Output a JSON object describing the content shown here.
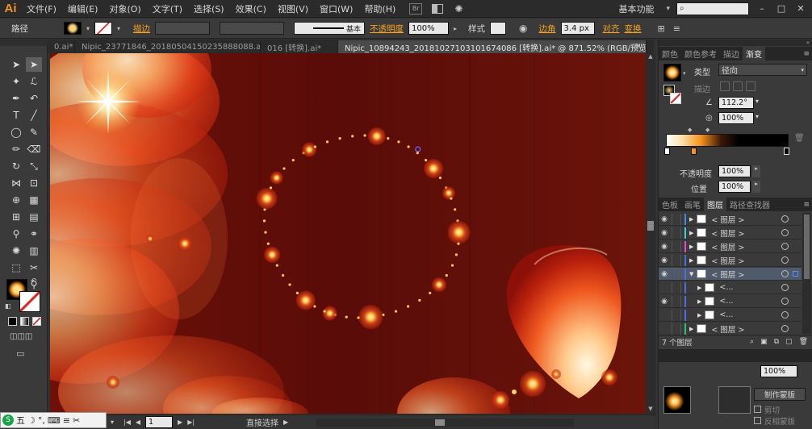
{
  "menubar": {
    "logo": "Ai",
    "menus": [
      "文件(F)",
      "编辑(E)",
      "对象(O)",
      "文字(T)",
      "选择(S)",
      "效果(C)",
      "视图(V)",
      "窗口(W)",
      "帮助(H)"
    ],
    "bridge": "Br",
    "workspace": "基本功能",
    "minimize": "–",
    "maximize": "□",
    "close": "✕"
  },
  "controlbar": {
    "selection_type": "路径",
    "stroke_label": "描边",
    "stroke_style": "基本",
    "opacity_label": "不透明度",
    "opacity_value": "100%",
    "style_label": "样式",
    "corner_label": "边角",
    "corner_value": "3.4 px",
    "align_label": "对齐",
    "transform_label": "变换"
  },
  "tabs": [
    {
      "label": "0.ai*",
      "active": false
    },
    {
      "label": "Nipic_23771846_20180504150235888088.ai*",
      "active": false
    },
    {
      "label": "016 [转换].ai*",
      "active": false
    },
    {
      "label": "Nipic_10894243_20181027103101674086 [转换].ai* @ 871.52% (RGB/预览)",
      "active": true
    }
  ],
  "status": {
    "zoom": "871.52%",
    "page": "1",
    "tool": "直接选择",
    "ime": [
      "五",
      "☽",
      "°,",
      "⌨",
      "≡",
      "✂"
    ]
  },
  "gradient_panel": {
    "tabs": [
      "颜色",
      "颜色参考",
      "描边",
      "渐变"
    ],
    "active_tab": "渐变",
    "type_label": "类型",
    "type_value": "径向",
    "stroke_label": "描边",
    "angle_value": "112.2°",
    "aspect_value": "100%",
    "opacity_label": "不透明度",
    "opacity_value": "100%",
    "location_label": "位置",
    "location_value": "100%"
  },
  "layers_panel": {
    "tabs": [
      "色板",
      "画笔",
      "图层",
      "路径查找器"
    ],
    "active_tab": "图层",
    "rows": [
      {
        "label": "< 图层 >",
        "indent": 0,
        "color": "#3a8ee6",
        "expanded": false,
        "eye": true
      },
      {
        "label": "< 图层 >",
        "indent": 0,
        "color": "#3bd0d0",
        "expanded": false,
        "eye": true
      },
      {
        "label": "< 图层 >",
        "indent": 0,
        "color": "#e04bd4",
        "expanded": false,
        "eye": true
      },
      {
        "label": "< 图层 >",
        "indent": 0,
        "color": "#4a6ee0",
        "expanded": false,
        "eye": true
      },
      {
        "label": "< 图层 >",
        "indent": 0,
        "color": "#4a6ee0",
        "expanded": true,
        "eye": true,
        "selected": true
      },
      {
        "label": "<...",
        "indent": 1,
        "color": "#4a6ee0",
        "expanded": false,
        "eye": false
      },
      {
        "label": "<...",
        "indent": 1,
        "color": "#4a6ee0",
        "expanded": false,
        "eye": true
      },
      {
        "label": "<...",
        "indent": 1,
        "color": "#4a6ee0",
        "expanded": false,
        "eye": false
      },
      {
        "label": "< 图层 >",
        "indent": 0,
        "color": "#2ec07a",
        "expanded": false,
        "eye": false
      }
    ],
    "count": "7 个图层"
  },
  "transparency_panel": {
    "make_mask": "制作蒙版",
    "clip": "剪切",
    "invert_mask": "反相蒙版",
    "opacity_value": "100%"
  },
  "colors": {
    "accent": "#f7931e",
    "canvas_bg": "#5b0d08",
    "panel_bg": "#3a3a3a"
  }
}
